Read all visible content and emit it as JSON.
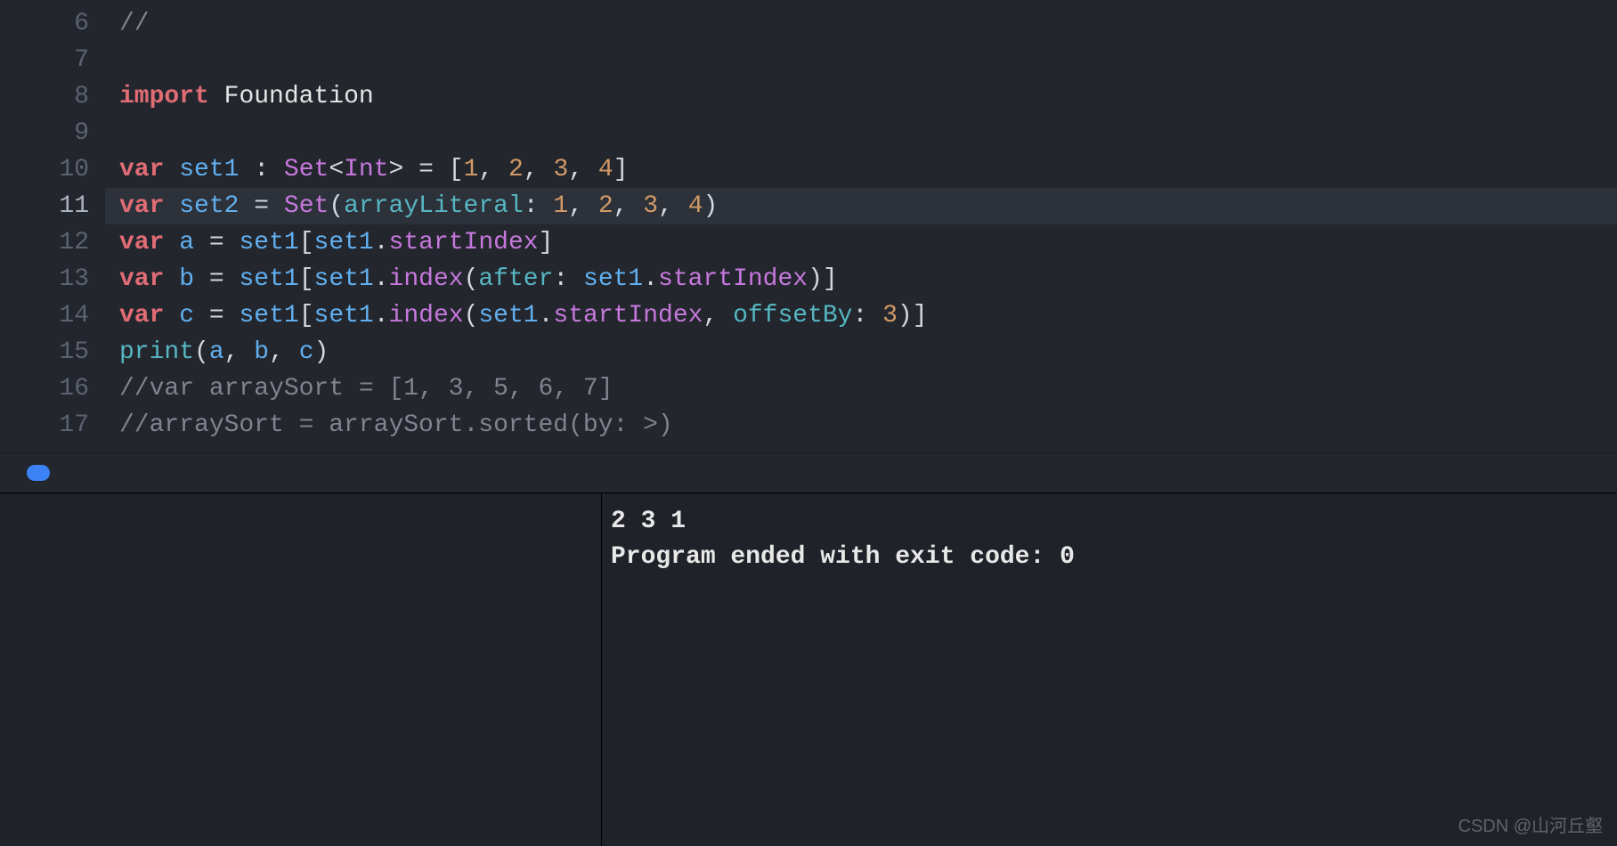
{
  "editor": {
    "gutter_start": 6,
    "gutter_end": 17,
    "highlighted_line": 11,
    "lines": {
      "l6": {
        "comment": "//"
      },
      "l7": {},
      "l8": {
        "kw": "import",
        "mod": "Foundation"
      },
      "l9": {},
      "l10": {
        "kw": "var",
        "name": "set1",
        "sp1": " ",
        "colon": ":",
        "sp2": " ",
        "type1": "Set",
        "lt": "<",
        "type2": "Int",
        "gt": ">",
        "sp3": " ",
        "eq": "=",
        "sp4": " ",
        "lb": "[",
        "n1": "1",
        "c1": ",",
        "s1": " ",
        "n2": "2",
        "c2": ",",
        "s2": " ",
        "n3": "3",
        "c3": ",",
        "s3": " ",
        "n4": "4",
        "rb": "]"
      },
      "l11": {
        "kw": "var",
        "name": "set2",
        "sp1": " ",
        "eq": "=",
        "sp2": " ",
        "type": "Set",
        "lp": "(",
        "label": "arrayLiteral",
        "colon": ":",
        "sp3": " ",
        "n1": "1",
        "c1": ",",
        "s1": " ",
        "n2": "2",
        "c2": ",",
        "s2": " ",
        "n3": "3",
        "c3": ",",
        "s3": " ",
        "n4": "4",
        "rp": ")"
      },
      "l12": {
        "kw": "var",
        "name": "a",
        "sp1": " ",
        "eq": "=",
        "sp2": " ",
        "obj": "set1",
        "lb": "[",
        "obj2": "set1",
        "dot": ".",
        "prop": "startIndex",
        "rb": "]"
      },
      "l13": {
        "kw": "var",
        "name": "b",
        "sp1": " ",
        "eq": "=",
        "sp2": " ",
        "obj": "set1",
        "lb": "[",
        "obj2": "set1",
        "dot": ".",
        "fn": "index",
        "lp": "(",
        "label": "after",
        "colon": ":",
        "sp3": " ",
        "obj3": "set1",
        "dot2": ".",
        "prop": "startIndex",
        "rp": ")",
        "rb": "]"
      },
      "l14": {
        "kw": "var",
        "name": "c",
        "sp1": " ",
        "eq": "=",
        "sp2": " ",
        "obj": "set1",
        "lb": "[",
        "obj2": "set1",
        "dot": ".",
        "fn": "index",
        "lp": "(",
        "obj3": "set1",
        "dot2": ".",
        "prop": "startIndex",
        "c1": ",",
        "s1": " ",
        "label": "offsetBy",
        "colon": ":",
        "sp3": " ",
        "n1": "3",
        "rp": ")",
        "rb": "]"
      },
      "l15": {
        "fn": "print",
        "lp": "(",
        "a1": "a",
        "c1": ",",
        "s1": " ",
        "a2": "b",
        "c2": ",",
        "s2": " ",
        "a3": "c",
        "rp": ")"
      },
      "l16": {
        "comment": "//var arraySort = [1, 3, 5, 6, 7]"
      },
      "l17": {
        "comment": "//arraySort = arraySort.sorted(by: >)"
      }
    }
  },
  "console": {
    "line1": "2 3 1",
    "line2": "Program ended with exit code: 0"
  },
  "watermark": "CSDN @山河丘壑"
}
